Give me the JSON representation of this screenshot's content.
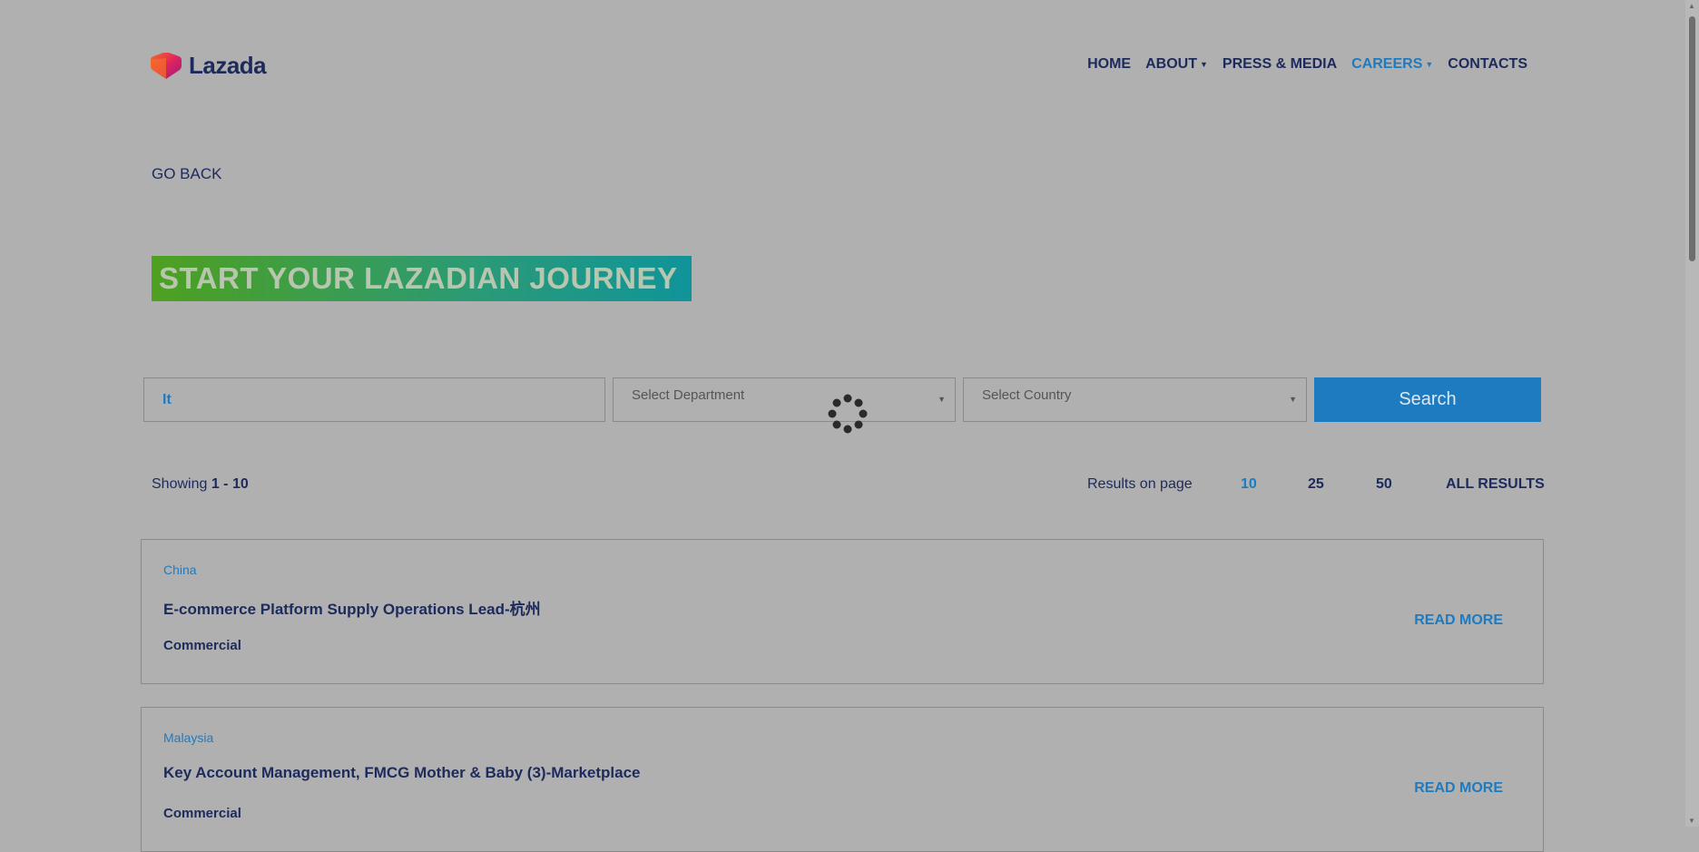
{
  "header": {
    "logo_text": "Lazada",
    "nav": [
      {
        "label": "HOME",
        "dropdown": false,
        "active": false
      },
      {
        "label": "ABOUT",
        "dropdown": true,
        "active": false
      },
      {
        "label": "PRESS & MEDIA",
        "dropdown": false,
        "active": false
      },
      {
        "label": "CAREERS",
        "dropdown": true,
        "active": true
      },
      {
        "label": "CONTACTS",
        "dropdown": false,
        "active": false
      }
    ]
  },
  "go_back": "GO BACK",
  "hero": {
    "title": "START YOUR LAZADIAN JOURNEY"
  },
  "search": {
    "keyword_value": "It",
    "department_placeholder": "Select Department",
    "country_placeholder": "Select Country",
    "button_label": "Search"
  },
  "results": {
    "showing_prefix": "Showing",
    "showing_range": "1 - 10",
    "per_page_label": "Results on page",
    "per_page_options": [
      "10",
      "25",
      "50",
      "ALL RESULTS"
    ],
    "selected_per_page": "10"
  },
  "jobs": [
    {
      "country": "China",
      "title": "E-commerce Platform Supply Operations Lead-杭州",
      "department": "Commercial",
      "action": "READ MORE"
    },
    {
      "country": "Malaysia",
      "title": "Key Account Management, FMCG Mother & Baby (3)-Marketplace",
      "department": "Commercial",
      "action": "READ MORE"
    }
  ],
  "colors": {
    "overlay_bg": "#b0b0b0",
    "accent": "#1f7bbf",
    "navy": "#1d2a5c"
  }
}
